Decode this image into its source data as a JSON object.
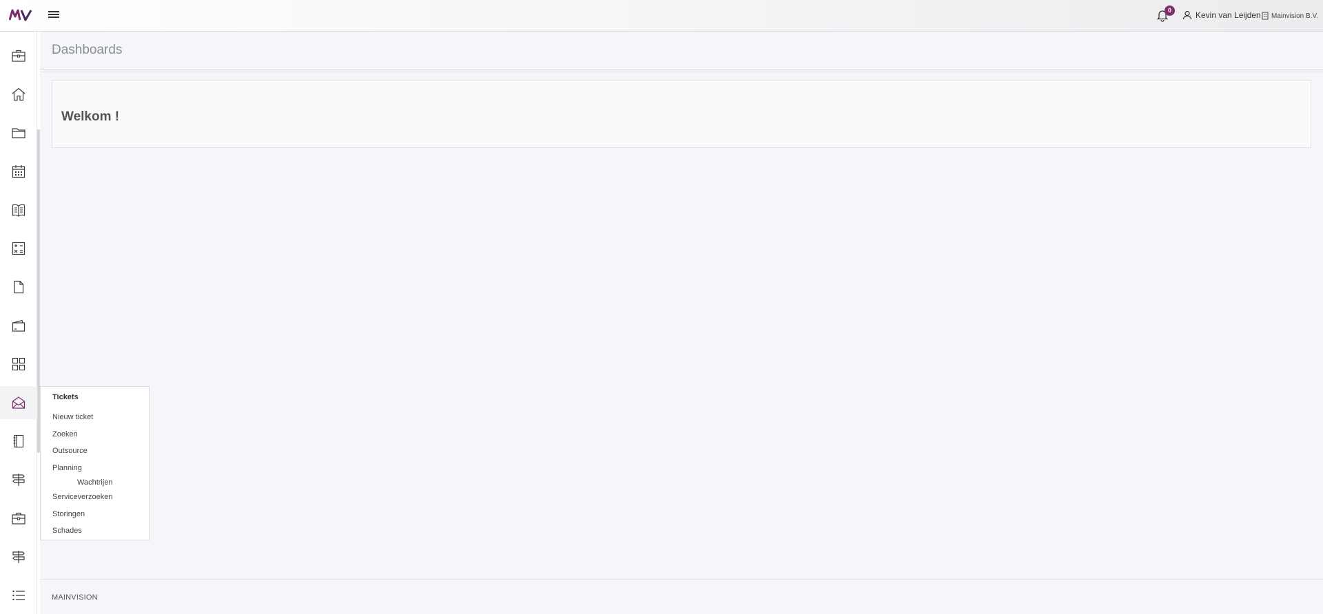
{
  "brand": {
    "logo_text": "MV",
    "accent": "#7b2d6b"
  },
  "topbar": {
    "notifications_count": "0",
    "user_name": "Kevin van Leijden",
    "company_name": "Mainvision B.V."
  },
  "sidebar": {
    "items": [
      {
        "icon": "briefcase-icon"
      },
      {
        "icon": "home-icon"
      },
      {
        "icon": "folder-icon"
      },
      {
        "icon": "calendar-icon"
      },
      {
        "icon": "book-icon"
      },
      {
        "icon": "calculator-icon"
      },
      {
        "icon": "document-icon"
      },
      {
        "icon": "wallet-icon"
      },
      {
        "icon": "grid-icon"
      },
      {
        "icon": "mail-icon",
        "active": true
      },
      {
        "icon": "notebook-icon"
      },
      {
        "icon": "signpost-icon"
      },
      {
        "icon": "briefcase-icon"
      },
      {
        "icon": "signpost-icon"
      },
      {
        "icon": "list-icon"
      }
    ]
  },
  "page": {
    "title": "Dashboards",
    "welcome": "Welkom !"
  },
  "flyout": {
    "title": "Tickets",
    "items": [
      {
        "label": "Nieuw ticket"
      },
      {
        "label": "Zoeken"
      },
      {
        "label": "Outsource"
      },
      {
        "label": "Planning"
      },
      {
        "label": "Wachtrijen",
        "sub": true
      },
      {
        "label": "Serviceverzoeken"
      },
      {
        "label": "Storingen"
      },
      {
        "label": "Schades"
      }
    ]
  },
  "footer": {
    "text": "MAINVISION"
  }
}
